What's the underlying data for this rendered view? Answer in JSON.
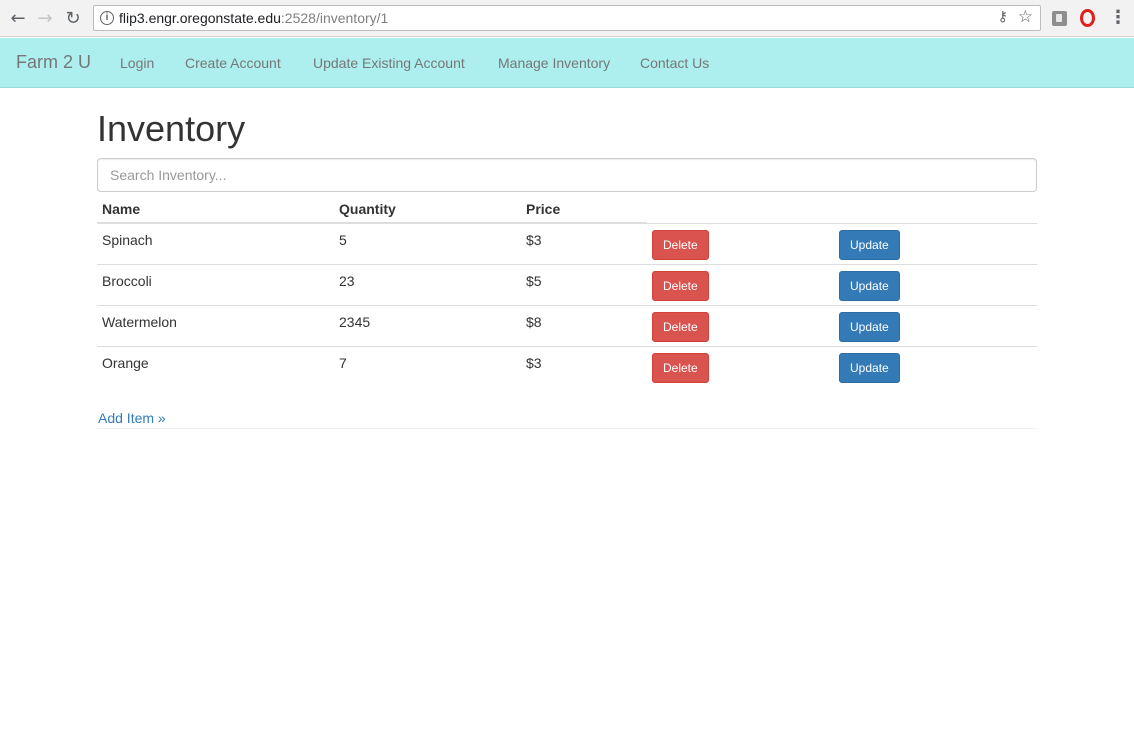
{
  "browser": {
    "url_host": "flip3.engr.oregonstate.edu",
    "url_path": ":2528/inventory/1",
    "icons": [
      "back-icon",
      "forward-icon",
      "reload-icon",
      "info-icon",
      "key-icon",
      "star-icon",
      "extension-icon",
      "opera-icon",
      "menu-icon"
    ]
  },
  "navbar": {
    "brand": "Farm 2 U",
    "links": [
      "Login",
      "Create Account",
      "Update Existing Account",
      "Manage Inventory",
      "Contact Us"
    ],
    "background": "#adeeee"
  },
  "main": {
    "title": "Inventory",
    "search_placeholder": "Search Inventory...",
    "table": {
      "headers": [
        "Name",
        "Quantity",
        "Price"
      ],
      "rows": [
        {
          "name": "Spinach",
          "quantity": "5",
          "price": "$3",
          "delete": "Delete",
          "update": "Update"
        },
        {
          "name": "Broccoli",
          "quantity": "23",
          "price": "$5",
          "delete": "Delete",
          "update": "Update"
        },
        {
          "name": "Watermelon",
          "quantity": "2345",
          "price": "$8",
          "delete": "Delete",
          "update": "Update"
        },
        {
          "name": "Orange",
          "quantity": "7",
          "price": "$3",
          "delete": "Delete",
          "update": "Update"
        }
      ]
    },
    "add_item": "Add Item »"
  },
  "colors": {
    "delete": "#d9534f",
    "update": "#337ab7",
    "link": "#337ab7"
  }
}
